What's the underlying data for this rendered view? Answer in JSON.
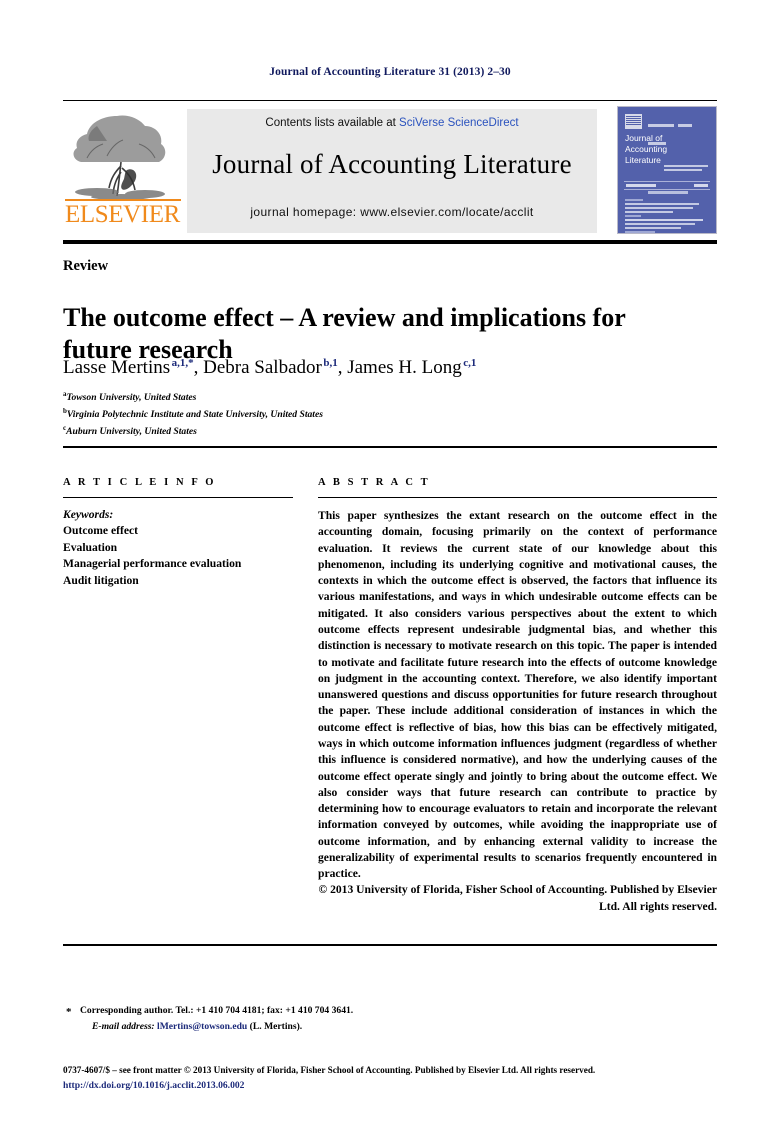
{
  "running_head": "Journal of Accounting Literature 31 (2013) 2–30",
  "masthead": {
    "contents_prefix": "Contents lists available at ",
    "contents_link": "SciVerse ScienceDirect",
    "journal_title": "Journal of Accounting Literature",
    "homepage": "journal homepage: www.elsevier.com/locate/acclit",
    "publisher_wordmark": "ELSEVIER",
    "cover": {
      "title_line1": "Journal of",
      "title_line2": "Accounting",
      "title_line3": "Literature"
    }
  },
  "article": {
    "section_label": "Review",
    "title": "The outcome effect – A review and implications for future research",
    "authors": [
      {
        "name": "Lasse Mertins",
        "marks": "a,1,*",
        "sep": ", "
      },
      {
        "name": "Debra Salbador",
        "marks": "b,1",
        "sep": ", "
      },
      {
        "name": "James H. Long",
        "marks": "c,1",
        "sep": ""
      }
    ],
    "affiliations": [
      {
        "mark": "a",
        "text": "Towson University, United States"
      },
      {
        "mark": "b",
        "text": "Virginia Polytechnic Institute and State University, United States"
      },
      {
        "mark": "c",
        "text": "Auburn University, United States"
      }
    ]
  },
  "info": {
    "heading": "A R T I C L E   I N F O",
    "keywords_label": "Keywords:",
    "keywords": [
      "Outcome effect",
      "Evaluation",
      "Managerial performance evaluation",
      "Audit litigation"
    ]
  },
  "abstract": {
    "heading": "A B S T R A C T",
    "text": "This paper synthesizes the extant research on the outcome effect in the accounting domain, focusing primarily on the context of performance evaluation. It reviews the current state of our knowledge about this phenomenon, including its underlying cognitive and motivational causes, the contexts in which the outcome effect is observed, the factors that influence its various manifestations, and ways in which undesirable outcome effects can be mitigated. It also considers various perspectives about the extent to which outcome effects represent undesirable judgmental bias, and whether this distinction is necessary to motivate research on this topic. The paper is intended to motivate and facilitate future research into the effects of outcome knowledge on judgment in the accounting context. Therefore, we also identify important unanswered questions and discuss opportunities for future research throughout the paper. These include additional consideration of instances in which the outcome effect is reflective of bias, how this bias can be effectively mitigated, ways in which outcome information influences judgment (regardless of whether this influence is considered normative), and how the underlying causes of the outcome effect operate singly and jointly to bring about the outcome effect. We also consider ways that future research can contribute to practice by determining how to encourage evaluators to retain and incorporate the relevant information conveyed by outcomes, while avoiding the inappropriate use of outcome information, and by enhancing external validity to increase the generalizability of experimental results to scenarios frequently encountered in practice.",
    "copyright": "© 2013 University of Florida, Fisher School of Accounting. Published by Elsevier Ltd. All rights reserved."
  },
  "footnotes": {
    "corresponding": "Corresponding author. Tel.: +1 410 704 4181; fax: +1 410 704 3641.",
    "email_label": "E-mail address:",
    "email": "lMertins@towson.edu",
    "email_owner": "(L. Mertins)."
  },
  "bottom": {
    "front_matter": "0737-4607/$ – see front matter © 2013 University of Florida, Fisher School of Accounting. Published by Elsevier Ltd. All rights reserved.",
    "doi": "http://dx.doi.org/10.1016/j.acclit.2013.06.002"
  },
  "colors": {
    "link_blue": "#1c2a7a",
    "sciencedirect_blue": "#2a52be",
    "elsevier_orange": "#f08a1c",
    "cover_blue": "#5361ab",
    "box_gray": "#e9e9e9"
  }
}
